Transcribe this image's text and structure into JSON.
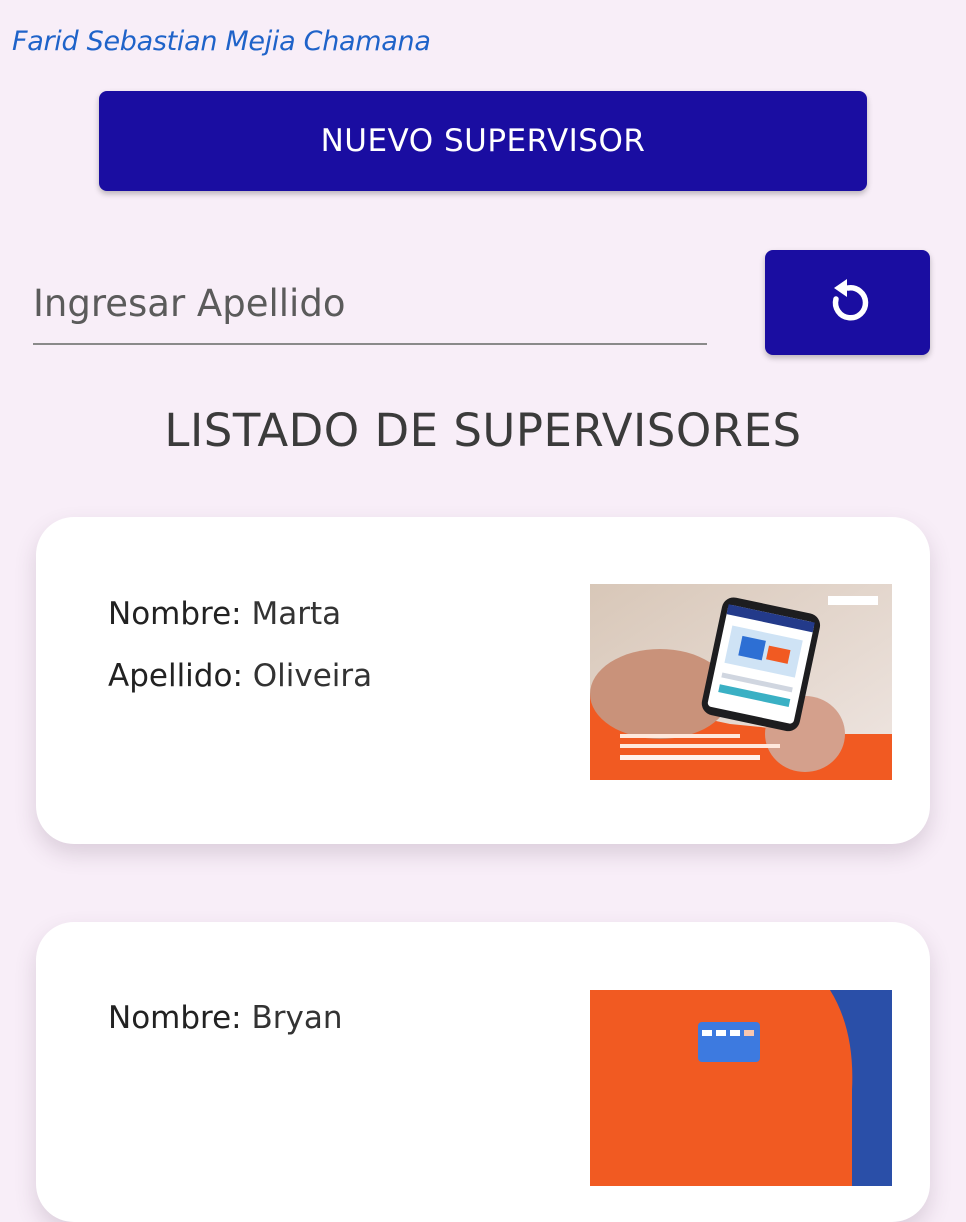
{
  "header": {
    "user_name": "Farid Sebastian Mejia Chamana"
  },
  "actions": {
    "new_supervisor_label": "NUEVO SUPERVISOR"
  },
  "search": {
    "placeholder": "Ingresar Apellido",
    "value": ""
  },
  "refresh": {
    "icon": "refresh-icon"
  },
  "list": {
    "title": "LISTADO DE SUPERVISORES",
    "name_label": "Nombre:",
    "surname_label": "Apellido:",
    "items": [
      {
        "nombre": "Marta",
        "apellido": "Oliveira"
      },
      {
        "nombre": "Bryan"
      }
    ]
  },
  "colors": {
    "primary": "#1a0da1",
    "background": "#f8eef8",
    "user_name": "#1f63c9",
    "thumb_orange": "#f15a22"
  }
}
